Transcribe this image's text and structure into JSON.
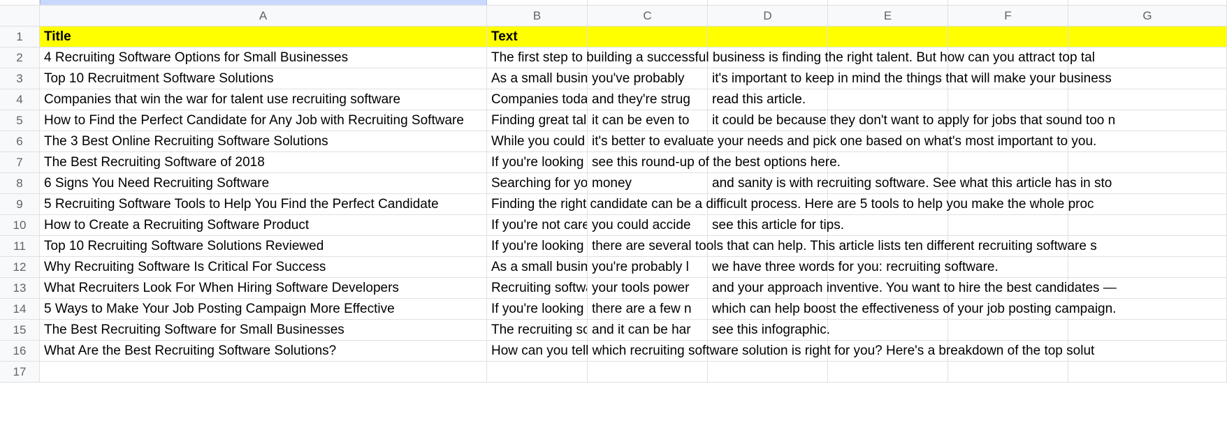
{
  "columns": [
    "A",
    "B",
    "C",
    "D",
    "E",
    "F",
    "G"
  ],
  "header_row": {
    "A": "Title",
    "B": "Text"
  },
  "rows": [
    {
      "A": "4 Recruiting Software Options for Small Businesses",
      "B_overflow": "The first step to building a successful business is finding the right talent. But how can you attract top tal"
    },
    {
      "A": "Top 10 Recruitment Software Solutions",
      "B": "As a small busin",
      "C": "you've probably ",
      "D_overflow": "it's important to keep in mind the things that will make your business "
    },
    {
      "A": "Companies that win the war for talent use recruiting software",
      "B": "Companies toda",
      "C": "and they're strug",
      "D_overflow": "read this article."
    },
    {
      "A": "How to Find the Perfect Candidate for Any Job with Recruiting Software",
      "B": "Finding great tal",
      "C": "it can be even to",
      "D_overflow": "it could be because they don't want to apply for jobs that sound too n"
    },
    {
      "A": "The 3 Best Online Recruiting Software Solutions",
      "B": "While you could ",
      "C_overflow": "it's better to evaluate your needs and pick one based on what's most important to you."
    },
    {
      "A": "The Best Recruiting Software of 2018",
      "B": "If you're looking ",
      "C_overflow": "see this round-up of the best options here."
    },
    {
      "A": "6 Signs You Need Recruiting Software",
      "B": "Searching for yo",
      "C": "money",
      "D_overflow": "and sanity is with recruiting software. See what this article has in sto"
    },
    {
      "A": "5 Recruiting Software Tools to Help You Find the Perfect Candidate",
      "B_overflow": "Finding the right candidate can be a difficult process. Here are 5 tools to help you make the whole proc"
    },
    {
      "A": "How to Create a Recruiting Software Product",
      "B": "If you're not care",
      "C": "you could accide",
      "D_overflow": "see this article for tips."
    },
    {
      "A": "Top 10 Recruiting Software Solutions Reviewed",
      "B": "If you're looking ",
      "C_overflow": "there are several tools that can help. This article lists ten different recruiting software s"
    },
    {
      "A": "Why Recruiting Software Is Critical For Success",
      "B": "As a small busin",
      "C": "you're probably l",
      "D_overflow": "we have three words for you: recruiting software."
    },
    {
      "A": "What Recruiters Look For When Hiring Software Developers",
      "B": "Recruiting softwa",
      "C": "your tools power",
      "D_overflow": "and your approach inventive. You want to hire the best candidates —"
    },
    {
      "A": "5 Ways to Make Your Job Posting Campaign More Effective",
      "B": "If you're looking ",
      "C": "there are a few n",
      "D_overflow": "which can help boost the effectiveness of your job posting campaign."
    },
    {
      "A": "The Best Recruiting Software for Small Businesses",
      "B": "The recruiting so",
      "C": "and it can be har",
      "D_overflow": "see this infographic."
    },
    {
      "A": "What Are the Best Recruiting Software Solutions?",
      "B_overflow": "How can you tell which recruiting software solution is right for you? Here's a breakdown of the top solut"
    },
    {
      "empty": true
    }
  ]
}
